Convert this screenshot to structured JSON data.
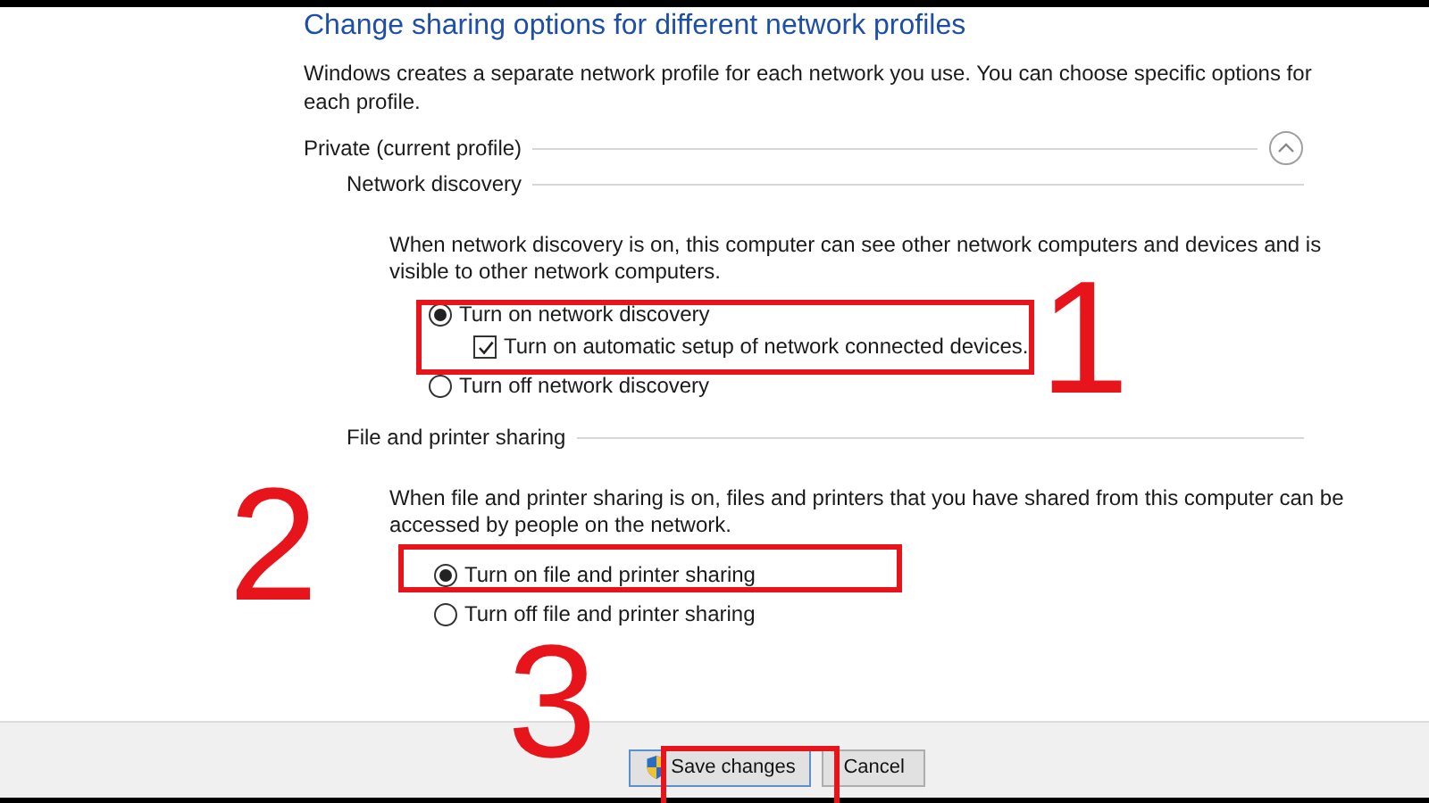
{
  "title": "Change sharing options for different network profiles",
  "description": "Windows creates a separate network profile for each network you use. You can choose specific options for each profile.",
  "profile": {
    "label": "Private (current profile)",
    "expanded": true
  },
  "sections": [
    {
      "heading": "Network discovery",
      "description": "When network discovery is on, this computer can see other network computers and devices and is visible to other network computers.",
      "options": [
        {
          "kind": "radio",
          "label": "Turn on network discovery",
          "selected": true
        },
        {
          "kind": "checkbox",
          "label": "Turn on automatic setup of network connected devices.",
          "checked": true
        },
        {
          "kind": "radio",
          "label": "Turn off network discovery",
          "selected": false
        }
      ]
    },
    {
      "heading": "File and printer sharing",
      "description": "When file and printer sharing is on, files and printers that you have shared from this computer can be accessed by people on the network.",
      "options": [
        {
          "kind": "radio",
          "label": "Turn on file and printer sharing",
          "selected": true
        },
        {
          "kind": "radio",
          "label": "Turn off file and printer sharing",
          "selected": false
        }
      ]
    }
  ],
  "buttons": [
    {
      "label": "Save changes",
      "kind": "shield"
    },
    {
      "label": "Cancel",
      "kind": "plain"
    }
  ],
  "annotations": [
    {
      "number": "1"
    },
    {
      "number": "2"
    },
    {
      "number": "3"
    }
  ]
}
